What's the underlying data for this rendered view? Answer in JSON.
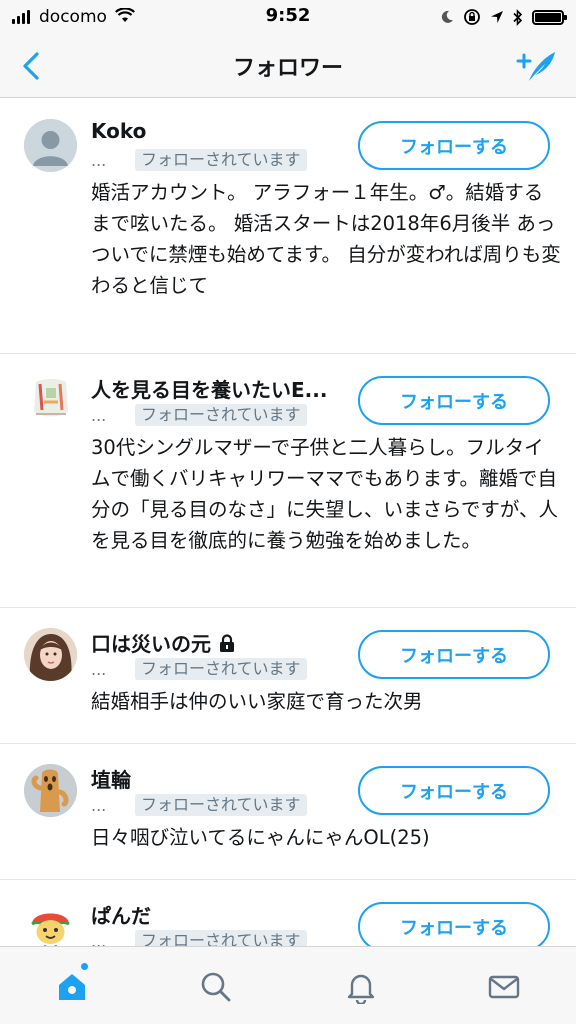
{
  "status_bar": {
    "carrier": "docomo",
    "time": "9:52"
  },
  "nav": {
    "title": "フォロワー"
  },
  "follow_label": "フォローする",
  "follows_you_label": "フォローされています",
  "users": [
    {
      "name": "Koko",
      "handle": "...",
      "bio": "婚活アカウント。 アラフォー１年生。♂。結婚するまで呟いたる。 婚活スタートは2018年6月後半 あっついでに禁煙も始めてます。 自分が変われば周りも変わると信じて",
      "locked": false
    },
    {
      "name": "人を見る目を養いたいE...",
      "handle": "...",
      "bio": "30代シングルマザーで子供と二人暮らし。フルタイムで働くバリキャリワーママでもあります。離婚で自分の「見る目のなさ」に失望し、いまさらですが、人を見る目を徹底的に養う勉強を始めました。",
      "locked": false
    },
    {
      "name": "口は災いの元",
      "handle": "...",
      "bio": "結婚相手は仲のいい家庭で育った次男",
      "locked": true
    },
    {
      "name": "埴輪",
      "handle": "...",
      "bio": "日々咽び泣いてるにゃんにゃんOL(25)",
      "locked": false
    },
    {
      "name": "ぱんだ",
      "handle": "...",
      "bio": "",
      "locked": false
    }
  ],
  "colors": {
    "accent": "#1da1f2",
    "text": "#14171a",
    "secondary": "#657786",
    "divider": "#e1e8ed"
  },
  "icons": {
    "back": "chevron-left-icon",
    "compose": "add-user-quill-icon",
    "tabs": [
      "home-icon",
      "search-icon",
      "notifications-bell-icon",
      "messages-envelope-icon"
    ]
  }
}
